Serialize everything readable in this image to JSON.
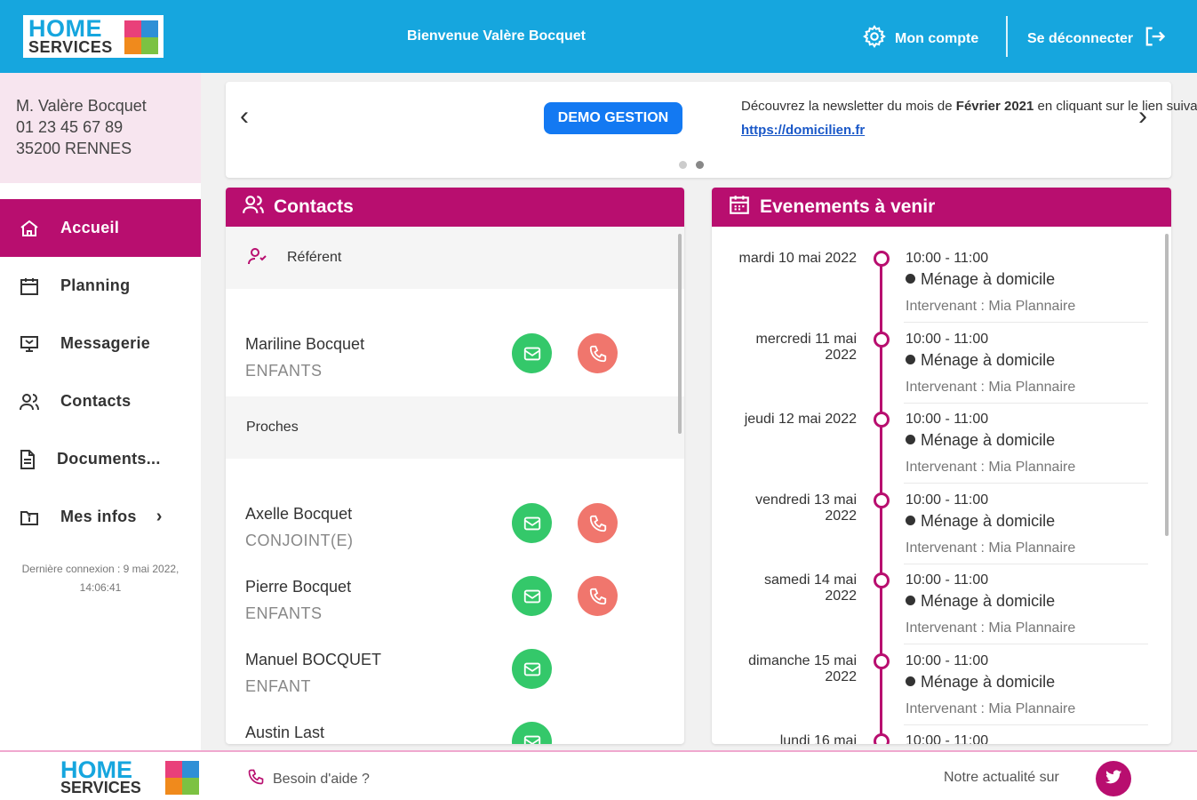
{
  "colors": {
    "brand_blue": "#16a6de",
    "brand_magenta": "#b80e6f",
    "badge_blue": "#1379f2",
    "mail_green": "#34c86a",
    "phone_red": "#f0766d"
  },
  "logo": {
    "line1": "HOME",
    "line2": "SERVICES"
  },
  "header": {
    "welcome": "Bienvenue Valère Bocquet",
    "account": "Mon compte",
    "logout": "Se déconnecter"
  },
  "user": {
    "name": "M. Valère Bocquet",
    "phone": "01 23 45 67 89",
    "city": "35200 RENNES"
  },
  "nav": [
    {
      "label": "Accueil",
      "icon": "home-icon",
      "active": true
    },
    {
      "label": "Planning",
      "icon": "calendar-icon"
    },
    {
      "label": "Messagerie",
      "icon": "message-icon"
    },
    {
      "label": "Contacts",
      "icon": "contacts-icon"
    },
    {
      "label": "Documents...",
      "icon": "document-icon"
    },
    {
      "label": "Mes infos",
      "icon": "info-icon"
    }
  ],
  "last_login": "Dernière connexion : 9 mai 2022, 14:06:41",
  "banner": {
    "badge": "DEMO GESTION",
    "text_before": "Découvrez la newsletter du mois de",
    "text_bold": "Février 2021",
    "text_after": "en cliquant sur le lien suivant :",
    "link": "https://domicilien.fr"
  },
  "contacts": {
    "title": "Contacts",
    "referent_label": "Référent",
    "proches_label": "Proches",
    "referent": [
      {
        "name": "Mariline Bocquet",
        "role": "ENFANTS",
        "mail": true,
        "phone": true
      }
    ],
    "proches": [
      {
        "name": "Axelle Bocquet",
        "role": "CONJOINT(E)",
        "mail": true,
        "phone": true
      },
      {
        "name": "Pierre Bocquet",
        "role": "ENFANTS",
        "mail": true,
        "phone": true
      },
      {
        "name": "Manuel BOCQUET",
        "role": "ENFANT",
        "mail": true,
        "phone": false
      },
      {
        "name": "Austin Last",
        "role": "",
        "mail": true,
        "phone": false
      }
    ]
  },
  "events": {
    "title": "Evenements à venir",
    "items": [
      {
        "date": "mardi 10 mai 2022",
        "time": "10:00 - 11:00",
        "activity": "Ménage à domicile",
        "worker": "Intervenant : Mia Plannaire"
      },
      {
        "date": "mercredi 11 mai 2022",
        "time": "10:00 - 11:00",
        "activity": "Ménage à domicile",
        "worker": "Intervenant : Mia Plannaire"
      },
      {
        "date": "jeudi 12 mai 2022",
        "time": "10:00 - 11:00",
        "activity": "Ménage à domicile",
        "worker": "Intervenant : Mia Plannaire"
      },
      {
        "date": "vendredi 13 mai 2022",
        "time": "10:00 - 11:00",
        "activity": "Ménage à domicile",
        "worker": "Intervenant : Mia Plannaire"
      },
      {
        "date": "samedi 14 mai 2022",
        "time": "10:00 - 11:00",
        "activity": "Ménage à domicile",
        "worker": "Intervenant : Mia Plannaire"
      },
      {
        "date": "dimanche 15 mai 2022",
        "time": "10:00 - 11:00",
        "activity": "Ménage à domicile",
        "worker": "Intervenant : Mia Plannaire"
      },
      {
        "date": "lundi 16 mai",
        "time": "10:00 - 11:00",
        "activity": "",
        "worker": ""
      }
    ]
  },
  "footer": {
    "help": "Besoin d'aide ?",
    "news_on": "Notre actualité sur"
  }
}
